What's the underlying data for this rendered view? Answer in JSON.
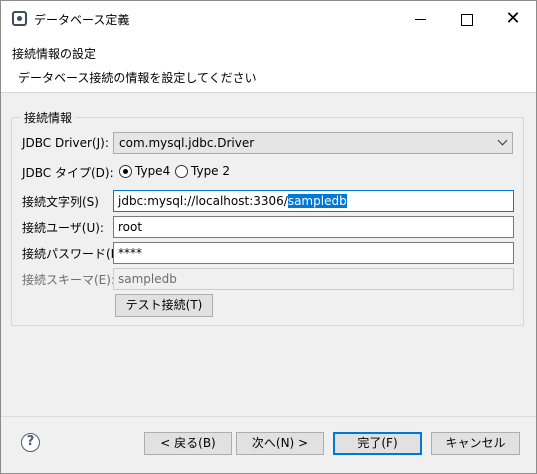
{
  "window": {
    "title": "データベース定義",
    "controls": {
      "minimize": "minimize",
      "maximize": "maximize",
      "close": "✕"
    }
  },
  "header": {
    "title": "接続情報の設定",
    "description": "データベース接続の情報を設定してください"
  },
  "group": {
    "legend": "接続情報",
    "driver": {
      "label": "JDBC Driver(J):",
      "value": "com.mysql.jdbc.Driver"
    },
    "type": {
      "label": "JDBC タイプ(D):",
      "options": [
        {
          "label": "Type4",
          "selected": true
        },
        {
          "label": "Type 2",
          "selected": false
        }
      ]
    },
    "connection_string": {
      "label": "接続文字列(S)",
      "value_prefix": "jdbc:mysql://localhost:3306/",
      "value_selected": "sampledb"
    },
    "user": {
      "label": "接続ユーザ(U):",
      "value": "root"
    },
    "password": {
      "label": "接続パスワード(P):",
      "value": "****"
    },
    "schema": {
      "label": "接続スキーマ(E):",
      "value": "sampledb"
    },
    "test_button": "テスト接続(T)"
  },
  "footer": {
    "help_icon": "?",
    "back": "< 戻る(B)",
    "next": "次へ(N) >",
    "finish": "完了(F)",
    "cancel": "キャンセル"
  }
}
